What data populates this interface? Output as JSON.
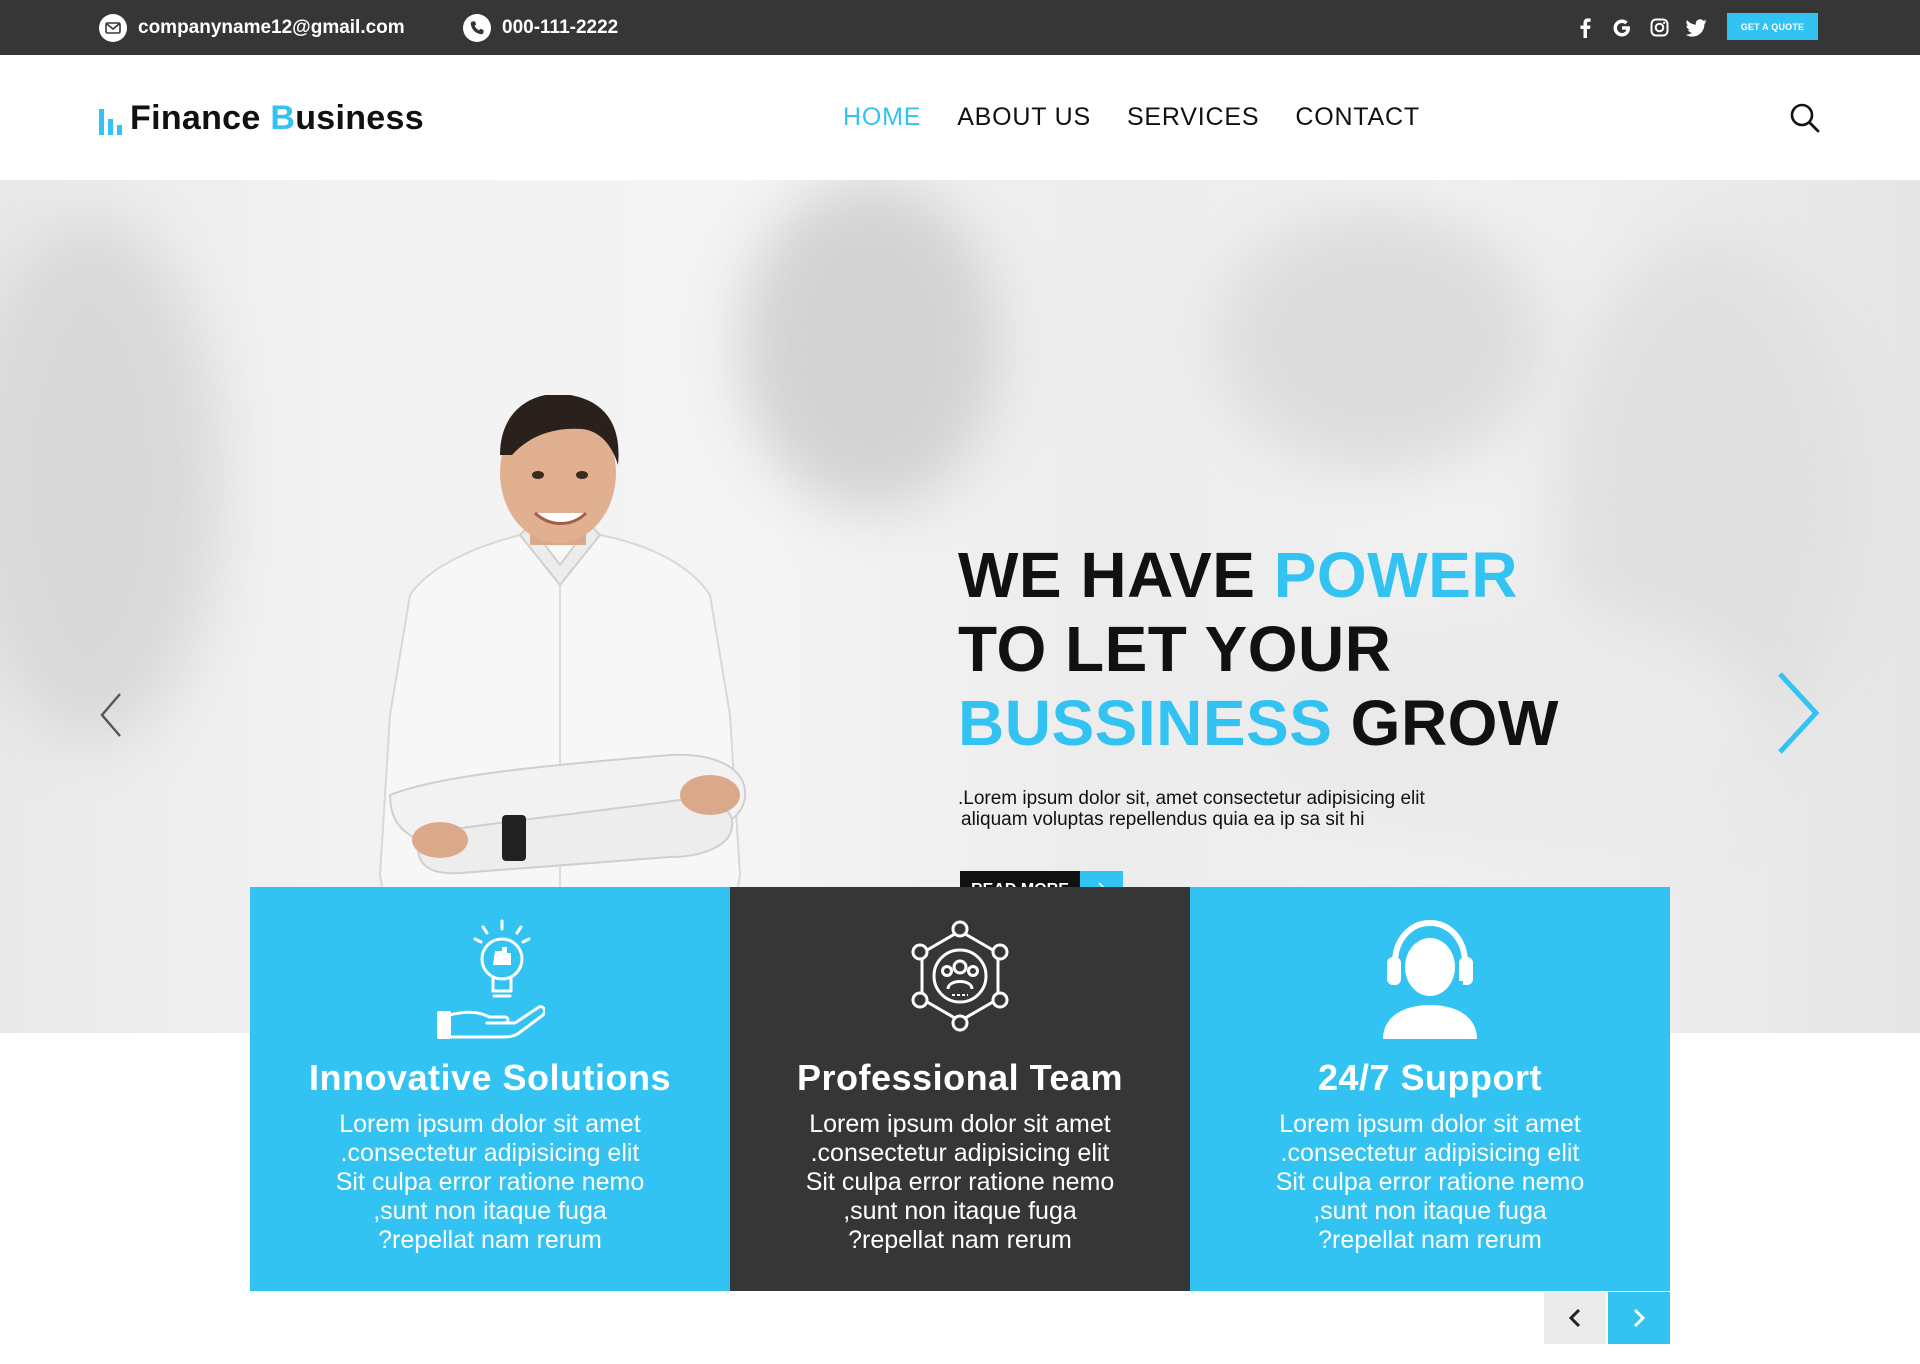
{
  "topbar": {
    "email": "companyname12@gmail.com",
    "phone": "000-111-2222",
    "socials": [
      "facebook-icon",
      "google-icon",
      "instagram-icon",
      "twitter-icon"
    ],
    "quote_label": "GET A QUOTE"
  },
  "header": {
    "logo_first": "Finance ",
    "logo_b": "B",
    "logo_rest": "usiness",
    "nav": [
      "HOME",
      "ABOUT US",
      "SERVICES",
      "CONTACT"
    ],
    "active_nav": "HOME"
  },
  "hero": {
    "line1_a": "WE HAVE ",
    "line1_b": "POWER",
    "line2": "TO LET YOUR",
    "line3_a": "BUSSINESS",
    "line3_b": " GROW",
    "text_line1": ".Lorem ipsum dolor sit, amet consectetur adipisicing elit",
    "text_line2": "aliquam voluptas repellendus quia ea ip  sa sit hi",
    "button_label": "READ MORE"
  },
  "features": [
    {
      "title": "Innovative Solutions",
      "icon": "lightbulb-hand-icon",
      "lines": [
        "Lorem ipsum dolor sit amet",
        ".consectetur adipisicing elit",
        "Sit culpa error ratione nemo",
        ",sunt non itaque fuga",
        "?repellat nam rerum"
      ]
    },
    {
      "title": "Professional Team",
      "icon": "team-network-icon",
      "lines": [
        "Lorem ipsum dolor sit amet",
        ".consectetur adipisicing elit",
        "Sit culpa error ratione nemo",
        ",sunt non itaque fuga",
        "?repellat nam rerum"
      ]
    },
    {
      "title": "24/7 Support",
      "icon": "headset-support-icon",
      "lines": [
        "Lorem ipsum dolor sit amet",
        ".consectetur adipisicing elit",
        "Sit culpa error ratione nemo",
        ",sunt non itaque fuga",
        "?repellat nam rerum"
      ]
    }
  ],
  "colors": {
    "accent": "#32c3f2",
    "dark": "#363636",
    "text": "#111111"
  }
}
